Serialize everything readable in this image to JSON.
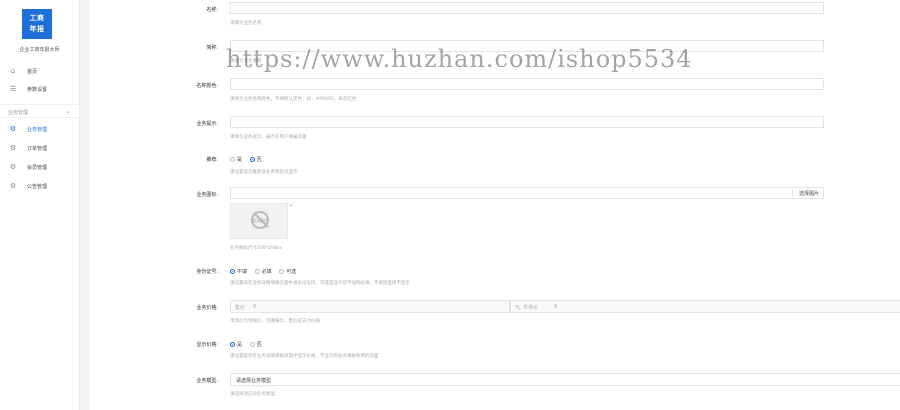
{
  "sidebar": {
    "logo_line1": "工商",
    "logo_line2": "年报",
    "app_name": "企业工商年报大师",
    "items_top": [
      {
        "label": "首页",
        "icon": "home-icon"
      },
      {
        "label": "参数设置",
        "icon": "list-icon"
      }
    ],
    "group_label": "业务管理",
    "items": [
      {
        "label": "业务管理",
        "icon": "gear-icon",
        "active": true
      },
      {
        "label": "订单管理",
        "icon": "gear-icon",
        "active": false
      },
      {
        "label": "会员管理",
        "icon": "gear-icon",
        "active": false
      },
      {
        "label": "公告管理",
        "icon": "gear-icon",
        "active": false
      }
    ]
  },
  "form": {
    "name": {
      "label": "名称:",
      "hint": "请填写业务名称"
    },
    "short_name": {
      "label": "简称:",
      "hint": "请填写业务简称"
    },
    "name_color": {
      "label": "名称颜色:",
      "hint": "请填写业务名称颜色，不填默认黑色，如：#ff0000，表示红色"
    },
    "tip": {
      "label": "业务提示:",
      "hint": "请填写业务提示，展示在用户填报页面"
    },
    "recommend": {
      "label": "推荐:",
      "options": [
        "是",
        "否"
      ],
      "selected": "否",
      "hint": "请设置首页推荐该业务到首页显示"
    },
    "image": {
      "label": "业务图标:",
      "button": "选择图片",
      "placeholder": "暂无图片",
      "close": "×",
      "hint": "业务图标尺寸200*200px"
    },
    "id_card": {
      "label": "身份证号:",
      "options": [
        "不填",
        "必填",
        "可选"
      ],
      "selected": "不填",
      "hint": "请设置该在业务详情填报页面中身份证号码，可选是显示但不强制必填，不填则直接不显示"
    },
    "price": {
      "label": "业务价格:",
      "left_prefix": "售价",
      "left_suffix": "¥",
      "right_prefix": "元, 市场价",
      "right_suffix": "¥",
      "unit": "元",
      "hint": "市场价为划线价，仅做展示，售价是支付价格"
    },
    "show_price": {
      "label": "显示价格:",
      "options": [
        "是",
        "否"
      ],
      "selected": "是",
      "hint": "请设置是否在业务详情填报页面中显示价格，不显示则业务填报免费的页面"
    },
    "template": {
      "label": "业务模型:",
      "value": "请选择业务模型",
      "hint": "请选择对应的业务模型"
    }
  },
  "watermark": "https://www.huzhan.com/ishop5534"
}
